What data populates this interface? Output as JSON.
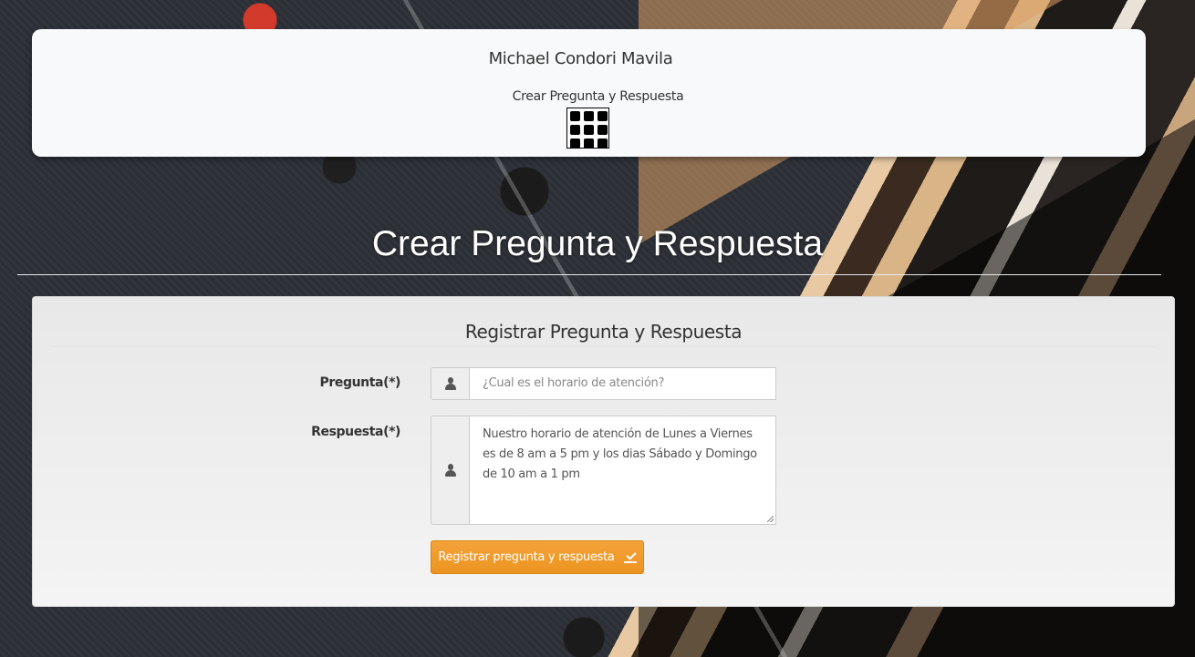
{
  "header": {
    "user_name": "Michael Condori Mavila",
    "page_subtitle": "Crear Pregunta y Respuesta",
    "menu_icon": "grid-icon"
  },
  "main": {
    "heading": "Crear Pregunta y Respuesta"
  },
  "form": {
    "title": "Registrar Pregunta y Respuesta",
    "question": {
      "label": "Pregunta(*)",
      "icon": "user-icon",
      "placeholder": "¿Cual es el horario de atención?",
      "value": ""
    },
    "answer": {
      "label": "Respuesta(*)",
      "icon": "user-icon",
      "lines": [
        "Nuestro horario de atención de Lunes a Viernes",
        "es de 8 am a 5 pm y los dias Sábado y Domingo",
        "de 10 am a 1 pm"
      ]
    },
    "submit": {
      "label": "Registrar pregunta y respuesta",
      "icon": "check-icon",
      "color": "#f0a030"
    }
  }
}
